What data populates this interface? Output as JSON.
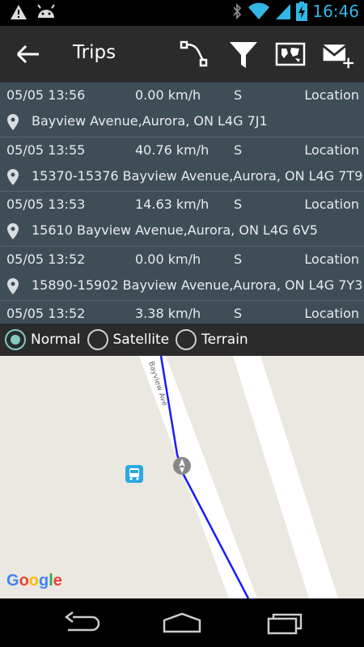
{
  "status_bar": {
    "time": "16:46",
    "left_icons": [
      "warning-icon",
      "android-icon"
    ],
    "right_icons": [
      "bluetooth-icon",
      "wifi-icon",
      "signal-icon",
      "battery-charging-icon"
    ]
  },
  "action_bar": {
    "title": "Trips",
    "icons": [
      "route-icon",
      "filter-icon",
      "map-image-icon",
      "mail-add-icon"
    ]
  },
  "trips": [
    {
      "time": "05/05 13:56",
      "speed": "0.00 km/h",
      "direction": "S",
      "type": "Location",
      "address": "Bayview Avenue,Aurora, ON L4G 7J1"
    },
    {
      "time": "05/05 13:55",
      "speed": "40.76 km/h",
      "direction": "S",
      "type": "Location",
      "address": "15370-15376 Bayview Avenue,Aurora, ON L4G 7T9"
    },
    {
      "time": "05/05 13:53",
      "speed": "14.63 km/h",
      "direction": "S",
      "type": "Location",
      "address": "15610 Bayview Avenue,Aurora, ON L4G 6V5"
    },
    {
      "time": "05/05 13:52",
      "speed": "0.00 km/h",
      "direction": "S",
      "type": "Location",
      "address": "15890-15902 Bayview Avenue,Aurora, ON L4G 7Y3"
    },
    {
      "time": "05/05 13:52",
      "speed": "3.38 km/h",
      "direction": "S",
      "type": "Location",
      "address": ""
    }
  ],
  "map_types": {
    "normal": "Normal",
    "satellite": "Satellite",
    "terrain": "Terrain",
    "selected": "Normal"
  },
  "map": {
    "street_label": "Bayview Ave",
    "logo_letters": [
      "G",
      "o",
      "o",
      "g",
      "l",
      "e"
    ],
    "logo_colors": [
      "#4285f4",
      "#ea4335",
      "#fbbc05",
      "#4285f4",
      "#34a853",
      "#ea4335"
    ],
    "route_color": "#1a1aff",
    "bus_stop_color": "#29a8e0"
  },
  "nav_bar": {
    "icons": [
      "back-nav-icon",
      "home-nav-icon",
      "recents-nav-icon"
    ]
  }
}
